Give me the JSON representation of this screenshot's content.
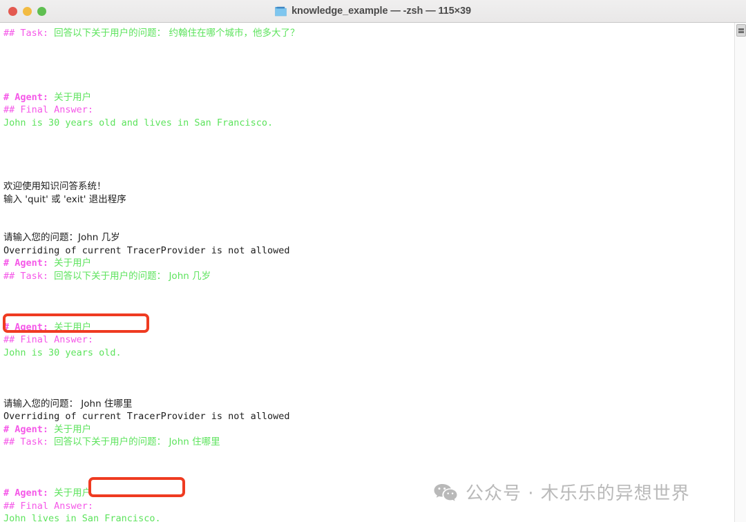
{
  "window": {
    "title": "knowledge_example — -zsh — 115×39",
    "folder_icon": "folder-icon",
    "traffic_lights": [
      {
        "name": "close",
        "color": "#e35950"
      },
      {
        "name": "minimize",
        "color": "#f2bb42"
      },
      {
        "name": "zoom",
        "color": "#5fbf51"
      }
    ]
  },
  "colors": {
    "background": "#ffffff",
    "magenta": "#f558e8",
    "green": "#5ce35c",
    "plain": "#1c1c1c",
    "annotation": "#ef3b21",
    "watermark": "#b9b9b9"
  },
  "scrollbar": {
    "thumb_icon": "split-pane-icon"
  },
  "terminal": {
    "lines": [
      {
        "id": 0,
        "segments": [
          {
            "text": "## Task: ",
            "style": "magenta"
          },
          {
            "text": "回答以下关于用户的问题： 约翰住在哪个城市，他多大了？",
            "style": "green"
          }
        ]
      },
      {
        "id": 1,
        "segments": []
      },
      {
        "id": 2,
        "segments": []
      },
      {
        "id": 3,
        "segments": []
      },
      {
        "id": 4,
        "segments": []
      },
      {
        "id": 5,
        "segments": [
          {
            "text": "# Agent: ",
            "style": "magenta-bold"
          },
          {
            "text": "关于用户",
            "style": "green"
          }
        ]
      },
      {
        "id": 6,
        "segments": [
          {
            "text": "## Final Answer:",
            "style": "magenta"
          }
        ]
      },
      {
        "id": 7,
        "segments": [
          {
            "text": "John is 30 years old and lives in San Francisco.",
            "style": "green"
          }
        ]
      },
      {
        "id": 8,
        "segments": []
      },
      {
        "id": 9,
        "segments": []
      },
      {
        "id": 10,
        "segments": []
      },
      {
        "id": 11,
        "segments": []
      },
      {
        "id": 12,
        "segments": [
          {
            "text": "欢迎使用知识问答系统！",
            "style": "plain"
          }
        ]
      },
      {
        "id": 13,
        "segments": [
          {
            "text": "输入 'quit' 或 'exit' 退出程序",
            "style": "plain"
          }
        ]
      },
      {
        "id": 14,
        "segments": []
      },
      {
        "id": 15,
        "segments": []
      },
      {
        "id": 16,
        "segments": [
          {
            "text": "请输入您的问题：John 几岁",
            "style": "plain"
          }
        ]
      },
      {
        "id": 17,
        "segments": [
          {
            "text": "Overriding of current TracerProvider is not allowed",
            "style": "plain"
          }
        ]
      },
      {
        "id": 18,
        "segments": [
          {
            "text": "# Agent: ",
            "style": "magenta-bold"
          },
          {
            "text": "关于用户",
            "style": "green"
          }
        ]
      },
      {
        "id": 19,
        "segments": [
          {
            "text": "## Task: ",
            "style": "magenta"
          },
          {
            "text": "回答以下关于用户的问题： John 几岁",
            "style": "green"
          }
        ]
      },
      {
        "id": 20,
        "segments": []
      },
      {
        "id": 21,
        "segments": []
      },
      {
        "id": 22,
        "segments": []
      },
      {
        "id": 23,
        "segments": [
          {
            "text": "# Agent: ",
            "style": "magenta-bold"
          },
          {
            "text": "关于用户",
            "style": "green"
          }
        ]
      },
      {
        "id": 24,
        "segments": [
          {
            "text": "## Final Answer:",
            "style": "magenta"
          }
        ]
      },
      {
        "id": 25,
        "segments": [
          {
            "text": "John is 30 years old.",
            "style": "green"
          }
        ]
      },
      {
        "id": 26,
        "segments": []
      },
      {
        "id": 27,
        "segments": []
      },
      {
        "id": 28,
        "segments": []
      },
      {
        "id": 29,
        "segments": [
          {
            "text": "请输入您的问题： John 住哪里",
            "style": "plain"
          }
        ]
      },
      {
        "id": 30,
        "segments": [
          {
            "text": "Overriding of current TracerProvider is not allowed",
            "style": "plain"
          }
        ]
      },
      {
        "id": 31,
        "segments": [
          {
            "text": "# Agent: ",
            "style": "magenta-bold"
          },
          {
            "text": "关于用户",
            "style": "green"
          }
        ]
      },
      {
        "id": 32,
        "segments": [
          {
            "text": "## Task: ",
            "style": "magenta"
          },
          {
            "text": "回答以下关于用户的问题： John 住哪里",
            "style": "green"
          }
        ]
      },
      {
        "id": 33,
        "segments": []
      },
      {
        "id": 34,
        "segments": []
      },
      {
        "id": 35,
        "segments": []
      },
      {
        "id": 36,
        "segments": [
          {
            "text": "# Agent: ",
            "style": "magenta-bold"
          },
          {
            "text": "关于用户",
            "style": "green"
          }
        ]
      },
      {
        "id": 37,
        "segments": [
          {
            "text": "## Final Answer:",
            "style": "magenta"
          }
        ]
      },
      {
        "id": 38,
        "segments": [
          {
            "text": "John lives in San Francisco.",
            "style": "green"
          }
        ]
      }
    ]
  },
  "annotations": [
    {
      "name": "highlight-age-answer",
      "label": "John is 30 years old."
    },
    {
      "name": "highlight-city-answer",
      "label": "San Francisco."
    }
  ],
  "watermark": {
    "icon": "wechat-icon",
    "text": "公众号 · 木乐乐的异想世界"
  }
}
